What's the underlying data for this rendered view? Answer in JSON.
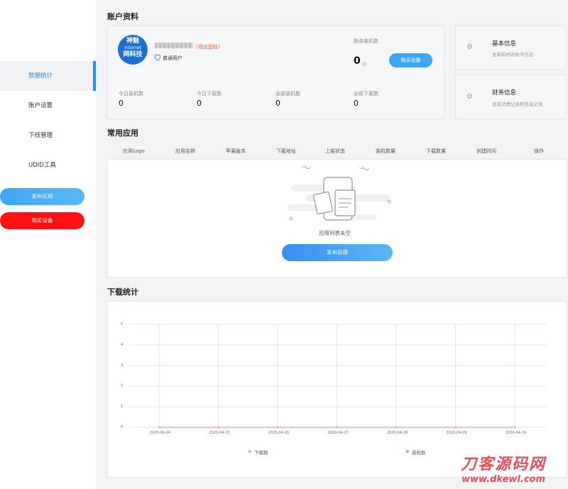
{
  "sidebar": {
    "items": [
      {
        "label": "数据统计"
      },
      {
        "label": "账户设置"
      },
      {
        "label": "下线管理"
      },
      {
        "label": "UDID工具"
      }
    ],
    "publish_label": "发布应用",
    "buy_label": "购买设备"
  },
  "account": {
    "section_title": "账户资料",
    "avatar_text": {
      "line1": "神魅",
      "line2": "internet",
      "line3": "网科技"
    },
    "logout_label": "(退出登陆)",
    "user_type": "普通用户",
    "remaining_label": "剩余装机数",
    "remaining_value": "0",
    "remaining_unit": "台",
    "buy_button": "购买设备",
    "stats": [
      {
        "label": "今日装机数",
        "value": "0"
      },
      {
        "label": "今日下载数",
        "value": "0"
      },
      {
        "label": "全部装机数",
        "value": "0"
      },
      {
        "label": "全部下载数",
        "value": "0"
      }
    ]
  },
  "side_cards": [
    {
      "title": "基本信息",
      "subtitle": "查看和修改账号信息"
    },
    {
      "title": "财务信息",
      "subtitle": "查看消费记录和充值记录"
    }
  ],
  "apps": {
    "section_title": "常用应用",
    "columns": [
      "应用Logo",
      "应用名称",
      "苹果版本",
      "下载地址",
      "上架状态",
      "装机数量",
      "下载数量",
      "创建时间",
      "操作"
    ],
    "empty_text": "应用列表未空",
    "publish_button": "发布应用"
  },
  "downloads": {
    "section_title": "下载统计"
  },
  "chart_data": {
    "type": "line",
    "x": [
      "2020-04-24",
      "2020-04-25",
      "2020-04-26",
      "2020-04-27",
      "2020-04-28",
      "2020-04-29",
      "2020-04-30"
    ],
    "yticks": [
      "5",
      "4",
      "3",
      "2",
      "1",
      "0"
    ],
    "ylim": [
      0,
      5
    ],
    "grid": true,
    "legend_position": "bottom",
    "series": [
      {
        "name": "下载数",
        "values": [
          0,
          0,
          0,
          0,
          0,
          0,
          0
        ],
        "color": "#f6a3d8"
      },
      {
        "name": "装机数",
        "values": [
          0,
          0,
          0,
          0,
          0,
          0,
          0
        ],
        "color": "#6ab8ec"
      }
    ]
  },
  "watermark": {
    "line1": "刀客源码网",
    "line2": "www.dkewl.com"
  },
  "colors": {
    "accent": "#2d8cf0",
    "danger": "#ff1111",
    "logout": "#ef5b3f"
  }
}
